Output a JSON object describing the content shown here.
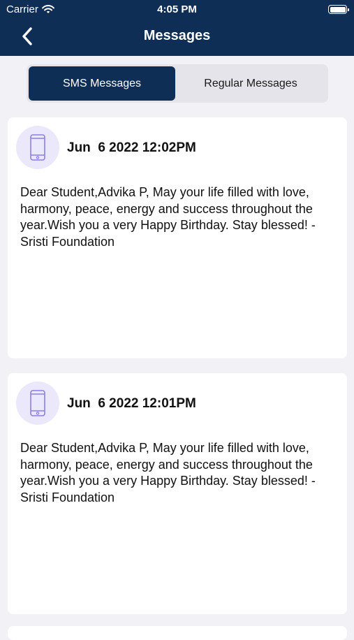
{
  "status_bar": {
    "carrier": "Carrier",
    "time": "4:05 PM",
    "battery_level": 1.0
  },
  "header": {
    "title": "Messages",
    "back_icon": "chevron-left-icon",
    "background_color": "#0e2e55"
  },
  "tabs": {
    "sms_label": "SMS Messages",
    "regular_label": "Regular Messages",
    "selected": "SMS Messages"
  },
  "messages": [
    {
      "icon": "phone-icon",
      "date": "Jun  6 2022 12:02PM",
      "body": "Dear Student,Advika P, May your life filled with love, harmony, peace, energy and success throughout the year.Wish you a very Happy Birthday. Stay blessed! - Sristi Foundation"
    },
    {
      "icon": "phone-icon",
      "date": "Jun  6 2022 12:01PM",
      "body": "Dear Student,Advika P, May your life filled with love, harmony, peace, energy and success throughout the year.Wish you a very Happy Birthday. Stay blessed! - Sristi Foundation"
    }
  ]
}
